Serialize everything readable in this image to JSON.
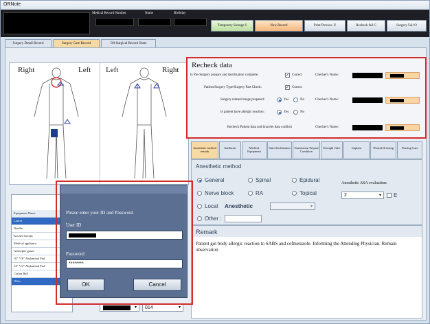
{
  "app": {
    "title": "ORNote"
  },
  "header": {
    "medical_record_number_label": "Medical Record Number",
    "name_label": "Name",
    "birthday_label": "Birthday"
  },
  "toolbar": {
    "temporary_storage": "Temporary Storage S",
    "new_record": "New Record",
    "print_preview": "Print Preview U",
    "recheck_fail": "Recheck fail C",
    "surgery_fail": "Surgery Fail O"
  },
  "tabs": [
    {
      "label": "Surgery Detail Record"
    },
    {
      "label": "Surgery Care Record"
    },
    {
      "label": "OA Surgical Record Sheet"
    }
  ],
  "body_map": {
    "front": {
      "right": "Right",
      "left": "Left"
    },
    "back": {
      "left": "Left",
      "right": "Right"
    }
  },
  "recheck": {
    "title": "Recheck data",
    "rows": [
      {
        "label": "Is Pre-Surgery prepare and sterilization complete:",
        "option": "Correct",
        "checker_label": "Checker's Name:"
      },
      {
        "label": "Patient/Surgery Type/Surgery Part Check:",
        "option": "Correct",
        "checker_label": ""
      },
      {
        "label": "Surgery related image prepared:",
        "yes": "Yes",
        "no": "No",
        "checker_label": "Checker's Name:"
      },
      {
        "label": "Is patient have allergic reaction:",
        "yes": "Yes",
        "no": "No",
        "checker_label": ""
      },
      {
        "label": "Recheck Patient data and bracelet data confirm",
        "checker_label": "Checker's Name:"
      }
    ]
  },
  "subtabs": [
    {
      "label": "Anesthetic method remark"
    },
    {
      "label": "Antibiotic"
    },
    {
      "label": "Medical Equipment"
    },
    {
      "label": "Skin Sterilization"
    },
    {
      "label": "Transfusion Prepare Condition"
    },
    {
      "label": "Drought Tube"
    },
    {
      "label": "Implant"
    },
    {
      "label": "Wound Dressing"
    },
    {
      "label": "Nursing Care"
    }
  ],
  "anesthetic": {
    "section_title": "Anesthetic method",
    "options": [
      "General",
      "Spinal",
      "Epidural",
      "Nerve block",
      "RA",
      "Topical",
      "Local"
    ],
    "anesthetic_label": "Anesthetic",
    "other_label": "Other :",
    "asa_label": "Anesthetic ASA evaluation:",
    "asa_value": "2",
    "e_label": "E"
  },
  "remark": {
    "title": "Remark",
    "text": "Patient got body allergic reaction to SABS and cefmetazole. Informing the Attending Physician. Remain observation"
  },
  "equipment": {
    "header": "Equipment Name",
    "items": [
      "Lancet",
      "Needle",
      "Kocher forceps",
      "Medical appliance",
      "Antiseptic gauze",
      "10\" *16\" Abdominal Pad",
      "12\" *12\" Abdominal Pad",
      "Cotton Ball",
      "Other"
    ]
  },
  "login_dialog": {
    "prompt": "Please enter your ID and Password",
    "user_id_label": "User ID",
    "password_label": "Password",
    "password_value": "********",
    "ok_label": "OK",
    "cancel_label": "Cancel"
  },
  "bottom": {
    "room_value": "014"
  }
}
